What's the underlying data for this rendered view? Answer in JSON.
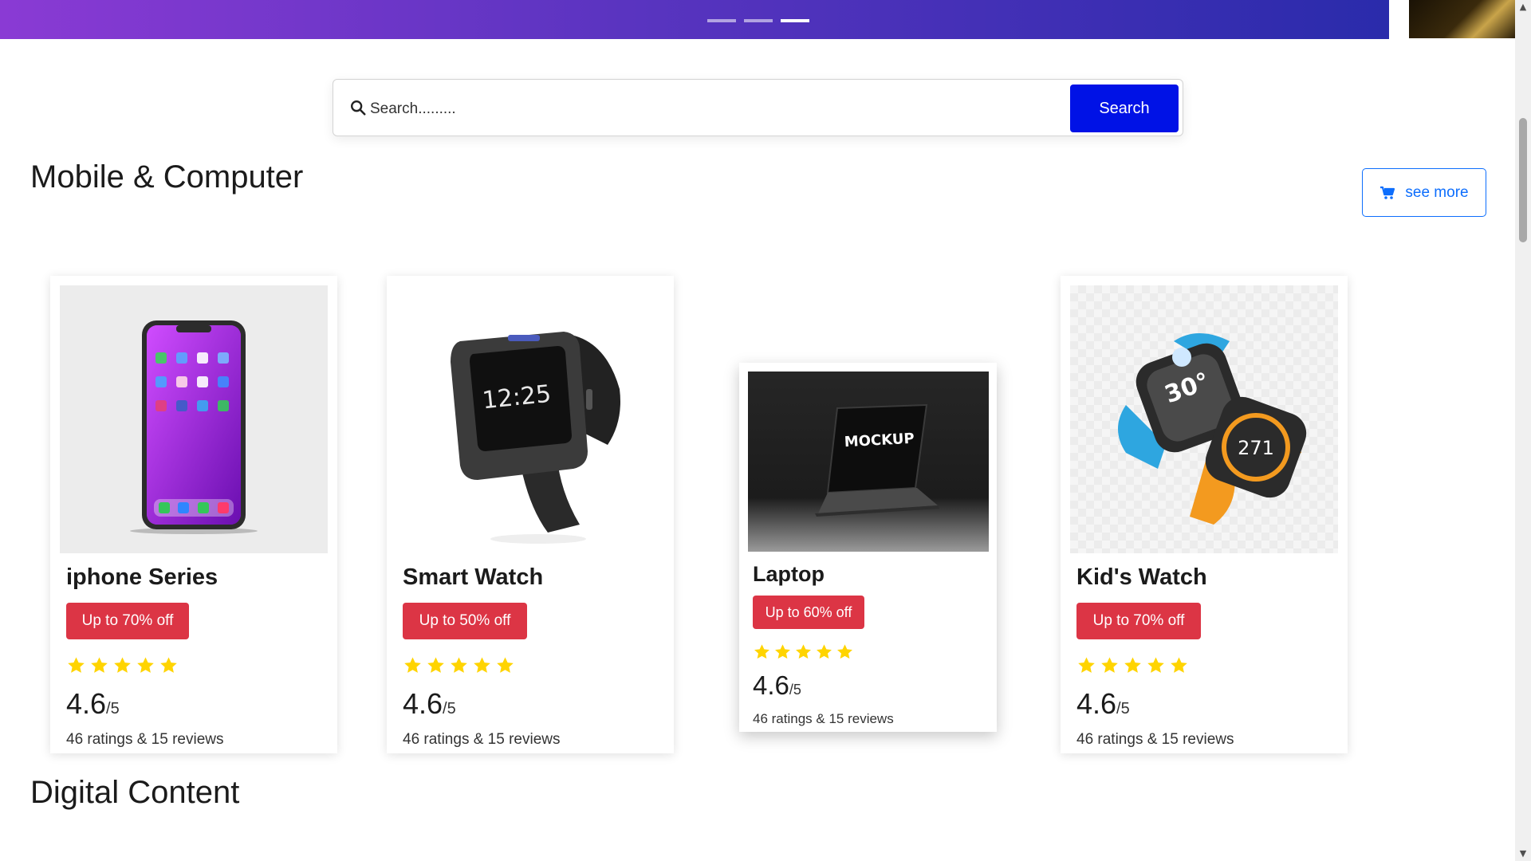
{
  "banner": {
    "indicator_count": 3,
    "active_indicator": 3
  },
  "search": {
    "placeholder": "Search.........",
    "button_label": "Search"
  },
  "sections": {
    "mobile_title": "Mobile & Computer",
    "see_more_label": "see more",
    "digital_title": "Digital Content"
  },
  "products": [
    {
      "name": "iphone Series",
      "discount": "Up to 70% off",
      "stars": 5,
      "rating": "4.6",
      "rating_max": "/5",
      "reviews": "46 ratings & 15 reviews"
    },
    {
      "name": "Smart Watch",
      "discount": "Up to 50% off",
      "stars": 5,
      "rating": "4.6",
      "rating_max": "/5",
      "reviews": "46 ratings & 15 reviews"
    },
    {
      "name": "Laptop",
      "discount": "Up to 60% off",
      "stars": 5,
      "rating": "4.6",
      "rating_max": "/5",
      "reviews": "46 ratings & 15 reviews",
      "image_text": "MOCKUP"
    },
    {
      "name": "Kid's Watch",
      "discount": "Up to 70% off",
      "stars": 5,
      "rating": "4.6",
      "rating_max": "/5",
      "reviews": "46 ratings & 15 reviews",
      "watch_text_1": "30°",
      "watch_text_2": "271"
    }
  ],
  "colors": {
    "banner_start": "#8a3ad4",
    "banner_end": "#2a2bab",
    "search_button": "#0012e6",
    "discount_badge": "#dc3545",
    "see_more": "#0d6efd",
    "star": "#ffd400"
  }
}
